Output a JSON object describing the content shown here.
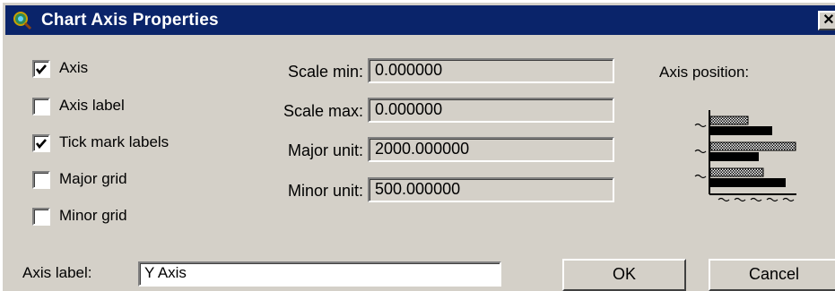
{
  "window": {
    "title": "Chart Axis Properties",
    "close_glyph": "✕"
  },
  "checkboxes": [
    {
      "label": "Axis",
      "checked": true
    },
    {
      "label": "Axis label",
      "checked": false
    },
    {
      "label": "Tick mark labels",
      "checked": true
    },
    {
      "label": "Major grid",
      "checked": false
    },
    {
      "label": "Minor grid",
      "checked": false
    }
  ],
  "fields": {
    "scale_min": {
      "label": "Scale min:",
      "value": "0.000000"
    },
    "scale_max": {
      "label": "Scale max:",
      "value": "0.000000"
    },
    "major_unit": {
      "label": "Major unit:",
      "value": "2000.000000"
    },
    "minor_unit": {
      "label": "Minor unit:",
      "value": "500.000000"
    }
  },
  "axis_position": {
    "label": "Axis position:"
  },
  "axis_label_input": {
    "label": "Axis label:",
    "value": "Y Axis"
  },
  "buttons": {
    "ok": "OK",
    "cancel": "Cancel"
  },
  "colors": {
    "title_bar": "#0a246a",
    "dialog_face": "#d4d0c8"
  }
}
